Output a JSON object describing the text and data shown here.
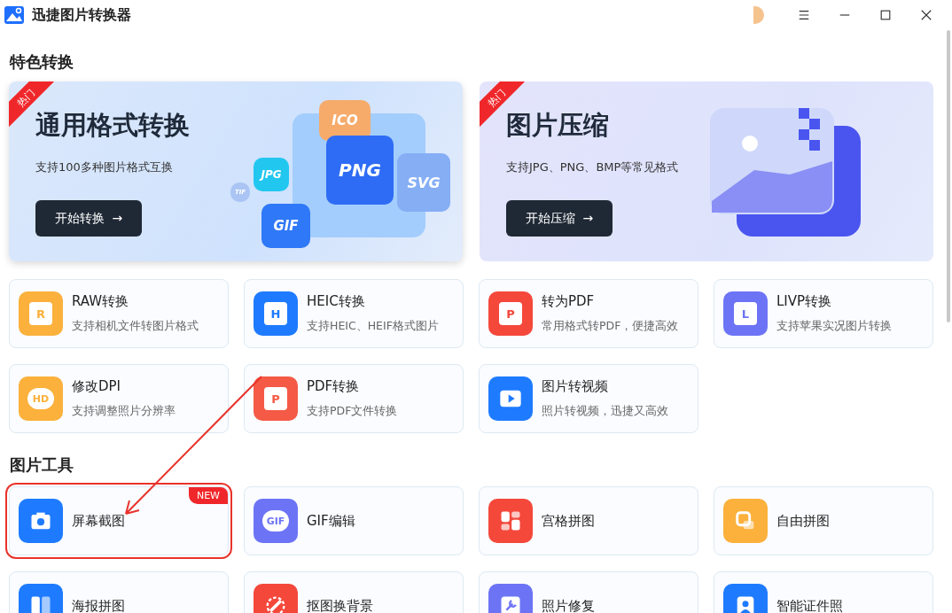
{
  "window": {
    "title": "迅捷图片转换器"
  },
  "featured": {
    "title": "特色转换",
    "banners": [
      {
        "kind": "formats",
        "tag": "热门",
        "title": "通用格式转换",
        "subtitle": "支持100多种图片格式互换",
        "button": "开始转换",
        "arrow": "→",
        "labels": [
          "ICO",
          "JPG",
          "PNG",
          "SVG",
          "GIF",
          "TIF"
        ]
      },
      {
        "kind": "compress",
        "tag": "热门",
        "title": "图片压缩",
        "subtitle": "支持JPG、PNG、BMP等常见格式",
        "button": "开始压缩",
        "arrow": "→"
      }
    ],
    "tools": [
      {
        "title": "RAW转换",
        "subtitle": "支持相机文件转图片格式",
        "kind": "letter",
        "icon_text": "R",
        "color": "#fbb13c"
      },
      {
        "title": "HEIC转换",
        "subtitle": "支持HEIC、HEIF格式图片",
        "kind": "letter",
        "icon_text": "H",
        "color": "#1e7bff"
      },
      {
        "title": "转为PDF",
        "subtitle": "常用格式转PDF，便捷高效",
        "kind": "letter",
        "icon_text": "P",
        "color": "#f4483b"
      },
      {
        "title": "LIVP转换",
        "subtitle": "支持苹果实况图片转换",
        "kind": "letter",
        "icon_text": "L",
        "color": "#6c74f5"
      },
      {
        "title": "修改DPI",
        "subtitle": "支持调整照片分辨率",
        "kind": "badge",
        "icon_text": "HD",
        "color": "#fbb13c"
      },
      {
        "title": "PDF转换",
        "subtitle": "支持PDF文件转换",
        "kind": "letter",
        "icon_text": "P",
        "color": "#f45a45"
      },
      {
        "title": "图片转视频",
        "subtitle": "照片转视频，迅捷又高效",
        "kind": "play",
        "color": "#1e7bff"
      }
    ]
  },
  "image_tools": {
    "title": "图片工具",
    "tools": [
      {
        "title": "屏幕截图",
        "kind": "camera",
        "color": "#1e7bff",
        "badge": "NEW",
        "highlighted": true
      },
      {
        "title": "GIF编辑",
        "kind": "badge",
        "icon_text": "GIF",
        "color": "#6c74f5",
        "highlighted": false
      },
      {
        "title": "宫格拼图",
        "kind": "grid",
        "color": "#f4483b",
        "highlighted": false
      },
      {
        "title": "自由拼图",
        "kind": "square",
        "color": "#fbb13c",
        "highlighted": false
      },
      {
        "title": "海报拼图",
        "kind": "poster",
        "color": "#1e7bff",
        "highlighted": false
      },
      {
        "title": "抠图换背景",
        "kind": "cutout",
        "color": "#f4483b",
        "highlighted": false
      },
      {
        "title": "照片修复",
        "kind": "wrench",
        "color": "#6c74f5",
        "highlighted": false
      },
      {
        "title": "智能证件照",
        "kind": "person",
        "color": "#1e7bff",
        "highlighted": false
      }
    ]
  }
}
